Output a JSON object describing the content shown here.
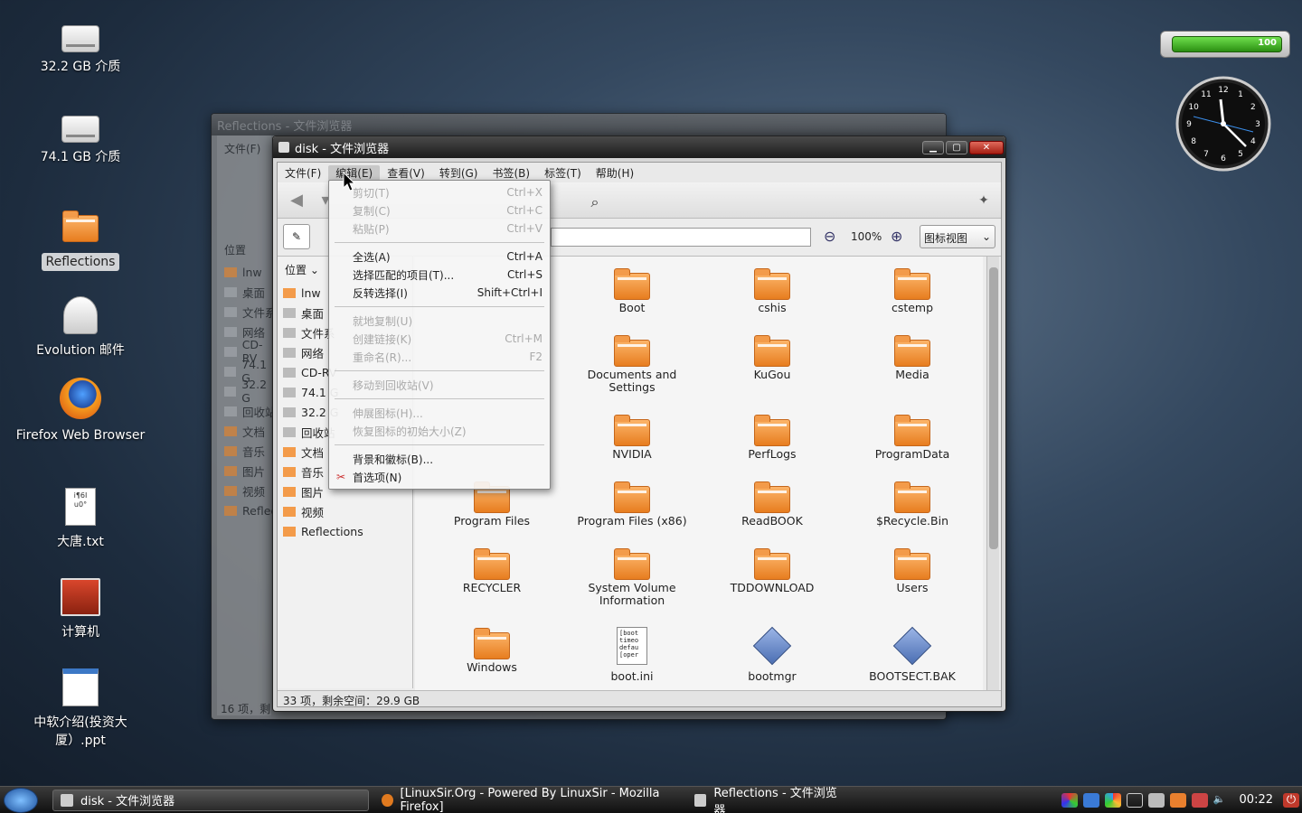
{
  "desktop": {
    "icons": [
      {
        "label": "32.2 GB 介质",
        "type": "drive"
      },
      {
        "label": "74.1 GB 介质",
        "type": "drive"
      },
      {
        "label": "Reflections",
        "type": "folder"
      },
      {
        "label": "Evolution 邮件",
        "type": "mail"
      },
      {
        "label": "Firefox Web Browser",
        "type": "firefox"
      },
      {
        "label": "大唐.txt",
        "type": "text",
        "preview": "i¶6I u0°"
      },
      {
        "label": "计算机",
        "type": "computer"
      },
      {
        "label": "中软介绍(投资大厦）.ppt",
        "type": "ppt"
      }
    ]
  },
  "battery": {
    "value": "100",
    "level": 100
  },
  "clock": {
    "numbers": [
      "12",
      "1",
      "2",
      "3",
      "4",
      "5",
      "6",
      "7",
      "8",
      "9",
      "10",
      "11"
    ]
  },
  "bg_window": {
    "title": "Reflections - 文件浏览器",
    "menu_first": "文件(F)",
    "places_label": "位置",
    "side_items": [
      "lnw",
      "桌面",
      "文件系",
      "网络",
      "CD-RV",
      "74.1 G",
      "32.2 G",
      "回收站",
      "文档",
      "音乐",
      "图片",
      "视频",
      "Reflec"
    ],
    "status": "16 项，剩"
  },
  "window": {
    "title": "disk - 文件浏览器",
    "menu": [
      "文件(F)",
      "编辑(E)",
      "查看(V)",
      "转到(G)",
      "书签(B)",
      "标签(T)",
      "帮助(H)"
    ],
    "zoom": "100%",
    "view_mode": "图标视图",
    "places_label": "位置",
    "side_items": [
      "lnw",
      "桌面",
      "文件系",
      "网络",
      "CD-RV",
      "74.1 G",
      "32.2 G",
      "回收站",
      "文档",
      "音乐",
      "图片",
      "视频",
      "Reflections"
    ],
    "files": [
      {
        "name": "Boot",
        "type": "folder"
      },
      {
        "name": "cshis",
        "type": "folder"
      },
      {
        "name": "cstemp",
        "type": "folder"
      },
      {
        "name": "Documents and Settings",
        "type": "folder"
      },
      {
        "name": "KuGou",
        "type": "folder"
      },
      {
        "name": "Media",
        "type": "folder"
      },
      {
        "name": "NVIDIA",
        "type": "folder"
      },
      {
        "name": "PerfLogs",
        "type": "folder"
      },
      {
        "name": "ProgramData",
        "type": "folder"
      },
      {
        "name": "Program Files",
        "type": "folder"
      },
      {
        "name": "Program Files (x86)",
        "type": "folder"
      },
      {
        "name": "ReadBOOK",
        "type": "folder"
      },
      {
        "name": "$Recycle.Bin",
        "type": "folder"
      },
      {
        "name": "RECYCLER",
        "type": "folder"
      },
      {
        "name": "System Volume Information",
        "type": "folder"
      },
      {
        "name": "TDDOWNLOAD",
        "type": "folder"
      },
      {
        "name": "Users",
        "type": "folder"
      },
      {
        "name": "Windows",
        "type": "folder"
      },
      {
        "name": "boot.ini",
        "type": "text",
        "preview": "[boot timeo defau [oper"
      },
      {
        "name": "bootmgr",
        "type": "binary"
      },
      {
        "name": "BOOTSECT.BAK",
        "type": "binary"
      }
    ],
    "status": "33 项，剩余空间：29.9 GB"
  },
  "edit_menu": {
    "groups": [
      [
        {
          "label": "剪切(T)",
          "shortcut": "Ctrl+X",
          "disabled": true
        },
        {
          "label": "复制(C)",
          "shortcut": "Ctrl+C",
          "disabled": true
        },
        {
          "label": "粘贴(P)",
          "shortcut": "Ctrl+V",
          "disabled": true
        }
      ],
      [
        {
          "label": "全选(A)",
          "shortcut": "Ctrl+A",
          "disabled": false
        },
        {
          "label": "选择匹配的项目(T)...",
          "shortcut": "Ctrl+S",
          "disabled": false
        },
        {
          "label": "反转选择(I)",
          "shortcut": "Shift+Ctrl+I",
          "disabled": false
        }
      ],
      [
        {
          "label": "就地复制(U)",
          "shortcut": "",
          "disabled": true
        },
        {
          "label": "创建链接(K)",
          "shortcut": "Ctrl+M",
          "disabled": true
        },
        {
          "label": "重命名(R)...",
          "shortcut": "F2",
          "disabled": true
        }
      ],
      [
        {
          "label": "移动到回收站(V)",
          "shortcut": "",
          "disabled": true
        }
      ],
      [
        {
          "label": "伸展图标(H)...",
          "shortcut": "",
          "disabled": true
        },
        {
          "label": "恢复图标的初始大小(Z)",
          "shortcut": "",
          "disabled": true
        }
      ],
      [
        {
          "label": "背景和徽标(B)...",
          "shortcut": "",
          "disabled": false
        },
        {
          "label": "首选项(N)",
          "shortcut": "",
          "disabled": false
        }
      ]
    ]
  },
  "taskbar": {
    "items": [
      "disk - 文件浏览器",
      "[LinuxSir.Org - Powered By LinuxSir - Mozilla Firefox]",
      "Reflections - 文件浏览器"
    ],
    "time": "00:22"
  },
  "colors": {
    "folder": "#f39b4a",
    "accent": "#2b6fd6",
    "close": "#c0392b"
  }
}
